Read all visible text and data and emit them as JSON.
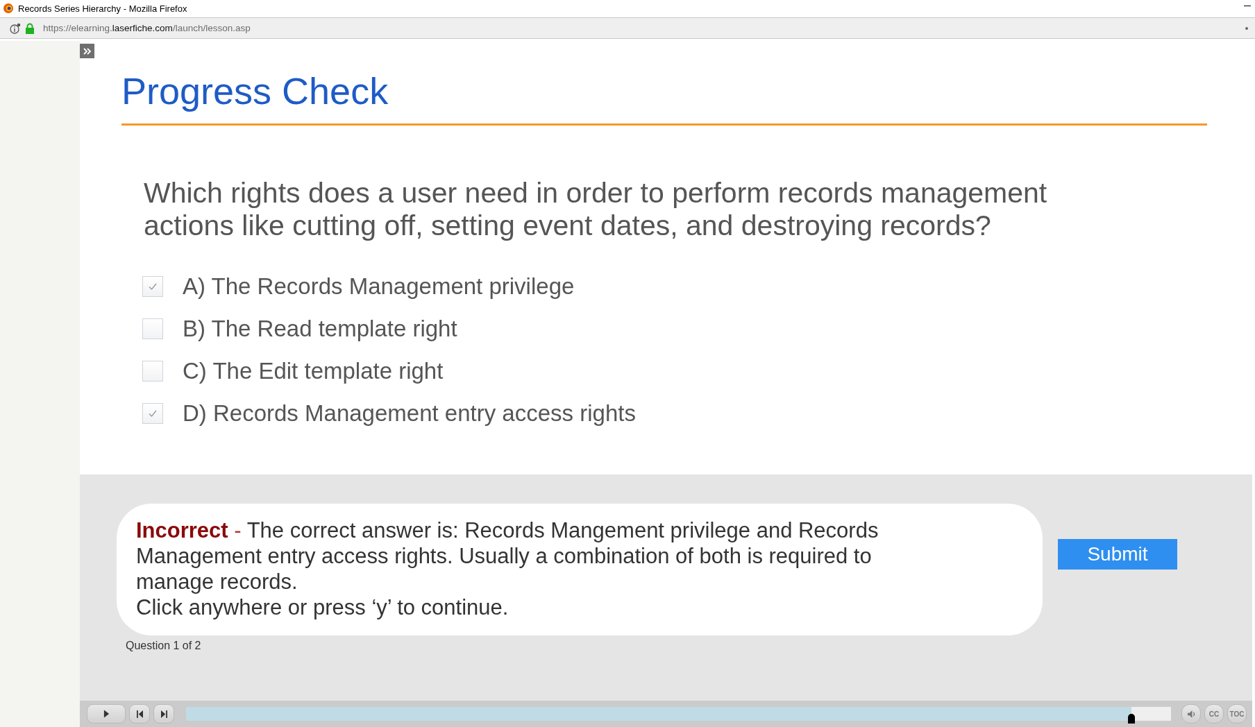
{
  "window": {
    "title": "Records Series Hierarchy - Mozilla Firefox"
  },
  "address_bar": {
    "url_prefix": "https://elearning.",
    "url_domain": "laserfiche.com",
    "url_path": "/launch/lesson.asp"
  },
  "slide": {
    "title": "Progress Check",
    "question": "Which rights does a user need in order to perform records management actions like cutting off, setting event dates, and destroying records?",
    "options": [
      {
        "label": "A) The Records Management privilege",
        "checked": true
      },
      {
        "label": "B) The Read template right",
        "checked": false
      },
      {
        "label": "C) The Edit template right",
        "checked": false
      },
      {
        "label": "D) Records Management entry access rights",
        "checked": true
      }
    ],
    "feedback": {
      "verdict": "Incorrect",
      "separator": "-",
      "message": "The correct answer is: Records Mangement privilege and Records Management entry access rights. Usually a combination of both is required to manage records.",
      "prompt": "Click anywhere or press ‘y’ to continue."
    },
    "submit_button": "Submit",
    "question_counter": "Question 1 of 2"
  },
  "player": {
    "progress": {
      "level": 0.96
    },
    "buttons": [
      {
        "kind": "volume"
      },
      {
        "kind": "text",
        "label": "CC"
      },
      {
        "kind": "text",
        "label": "TOC"
      }
    ]
  }
}
